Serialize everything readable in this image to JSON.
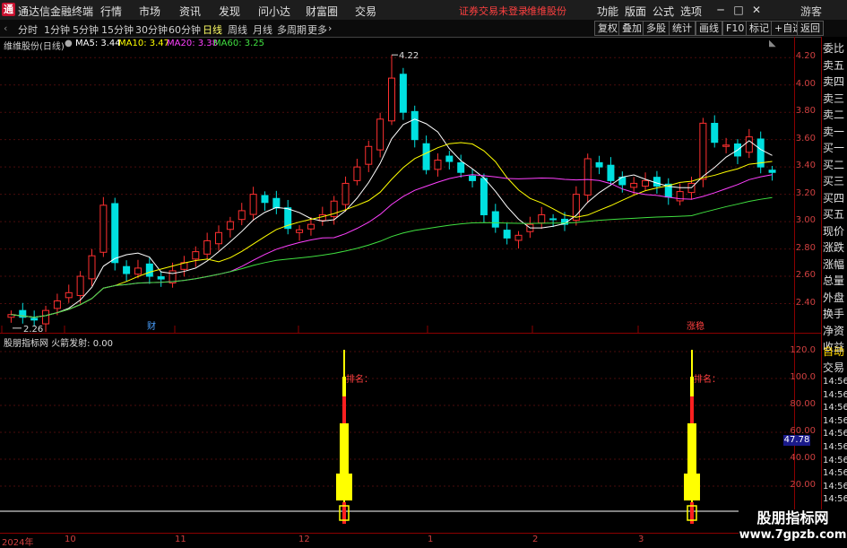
{
  "titlebar": {
    "logo": "通",
    "app_title": "通达信金融终端",
    "menus": [
      "行情",
      "市场",
      "资讯",
      "发现",
      "问小达",
      "财富圈",
      "交易"
    ],
    "notice": "证券交易未登录",
    "stock_name": "维维股份",
    "right_menus": [
      "功能",
      "版面",
      "公式",
      "选项"
    ],
    "guest": "游客"
  },
  "toolbar": {
    "periods": [
      "分时",
      "1分钟",
      "5分钟",
      "15分钟",
      "30分钟",
      "60分钟",
      "日线",
      "周线",
      "月线",
      "多周期",
      "更多"
    ],
    "active_period": "日线",
    "more_arrow": "›",
    "buttons": [
      "复权",
      "叠加",
      "多股",
      "统计",
      "画线",
      "F10",
      "标记",
      "+自选",
      "返回"
    ]
  },
  "main_chart": {
    "title": "维维股份(日线)",
    "ma": [
      {
        "label": "MA5: 3.44",
        "color": "#ffffff"
      },
      {
        "label": "MA10: 3.47",
        "color": "#ffff00"
      },
      {
        "label": "MA20: 3.38",
        "color": "#ff40ff"
      },
      {
        "label": "MA60: 3.25",
        "color": "#40e040"
      }
    ],
    "price_high_label": "4.22",
    "price_low_label": "2.26",
    "marker_cai": "财",
    "marker_zhangting": "涨稳",
    "y_ticks": [
      "4.20",
      "4.00",
      "3.80",
      "3.60",
      "3.40",
      "3.20",
      "3.00",
      "2.80",
      "2.60",
      "2.40"
    ]
  },
  "indicator": {
    "title": "股朋指标网  火箭发射: 0.00",
    "y_ticks": [
      "120.0",
      "100.0",
      "80.00",
      "60.00",
      "40.00",
      "20.00"
    ],
    "current_value": "47.78",
    "rocket_label": "排名："
  },
  "x_axis": [
    "2024年",
    "10",
    "11",
    "12",
    "1",
    "2",
    "3"
  ],
  "right_panel": {
    "items": [
      "委比",
      "卖五",
      "卖四",
      "卖三",
      "卖二",
      "卖一",
      "买一",
      "买二",
      "买三",
      "买四",
      "买五",
      "现价",
      "涨跌",
      "涨幅",
      "总量",
      "外盘",
      "换手",
      "净资",
      "收益"
    ],
    "lower": [
      "自动",
      "交易",
      "14:56",
      "14:56",
      "14:56",
      "14:56",
      "14:56",
      "14:56",
      "14:56",
      "14:56",
      "14:56",
      "14:56"
    ]
  },
  "watermark": {
    "line1": "股朋指标网",
    "line2": "www.7gpzb.com"
  },
  "chart_data": {
    "type": "candlestick",
    "title": "维维股份(日线)",
    "ylim": [
      2.2,
      4.3
    ],
    "x_labels": [
      "2024年",
      "10",
      "11",
      "12",
      "1",
      "2",
      "3"
    ],
    "high_mark": 4.22,
    "low_mark": 2.26,
    "close_approx": [
      2.32,
      2.3,
      2.28,
      2.35,
      2.42,
      2.48,
      2.6,
      2.75,
      3.12,
      2.7,
      2.62,
      2.66,
      2.6,
      2.58,
      2.64,
      2.7,
      2.78,
      2.86,
      2.92,
      3.0,
      3.08,
      3.2,
      3.14,
      3.1,
      2.95,
      2.94,
      2.98,
      3.05,
      3.15,
      3.28,
      3.4,
      3.55,
      3.75,
      4.05,
      3.8,
      3.6,
      3.38,
      3.45,
      3.44,
      3.36,
      3.3,
      3.05,
      2.96,
      2.88,
      2.9,
      2.98,
      3.05,
      3.02,
      2.98,
      3.2,
      3.46,
      3.4,
      3.3,
      3.27,
      3.28,
      3.3,
      3.26,
      3.18,
      3.22,
      3.28,
      3.72,
      3.58,
      3.56,
      3.48,
      3.62,
      3.4,
      3.36
    ],
    "ma": {
      "MA5": 3.44,
      "MA10": 3.47,
      "MA20": 3.38,
      "MA60": 3.25
    },
    "indicator_series": {
      "name": "火箭发射",
      "value": 0.0,
      "current": 47.78,
      "rockets_at_x_label_index": [
        3,
        6
      ]
    }
  }
}
